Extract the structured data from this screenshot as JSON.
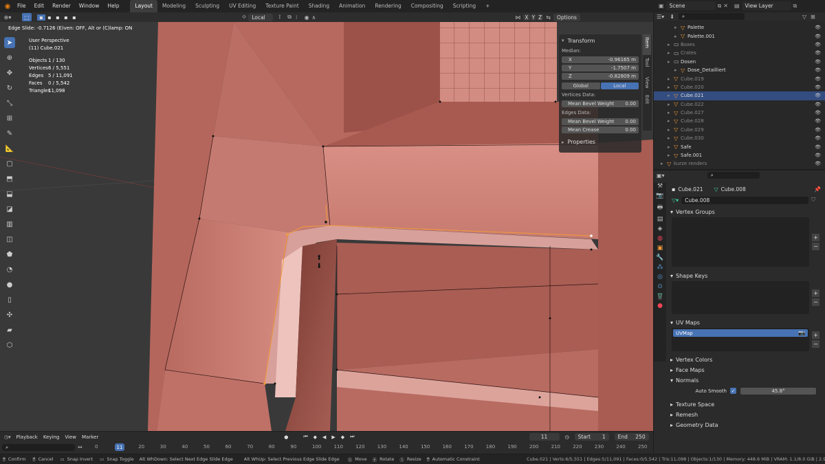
{
  "menu": [
    "File",
    "Edit",
    "Render",
    "Window",
    "Help"
  ],
  "workspaces": [
    "Layout",
    "Modeling",
    "Sculpting",
    "UV Editing",
    "Texture Paint",
    "Shading",
    "Animation",
    "Rendering",
    "Compositing",
    "Scripting"
  ],
  "scene": {
    "label": "Scene",
    "view_layer": "View Layer"
  },
  "viewport_header": {
    "transform_orientation": "Local",
    "options": "Options",
    "axes": [
      "X",
      "Y",
      "Z"
    ]
  },
  "status_msg": "Edge Slide: -0.7126 (E)ven: OFF, Alt or (C)lamp: ON",
  "overlay": {
    "view": "User Perspective",
    "object": "(11) Cube.021",
    "stats": [
      {
        "k": "Objects",
        "v": "1 / 130"
      },
      {
        "k": "Vertices",
        "v": "6 / 5,551"
      },
      {
        "k": "Edges",
        "v": "5 / 11,091"
      },
      {
        "k": "Faces",
        "v": "0 / 5,542"
      },
      {
        "k": "Triangles",
        "v": "11,098"
      }
    ]
  },
  "npanel": {
    "title": "Transform",
    "median": "Median:",
    "x_label": "X",
    "x": "-0.96165 m",
    "y_label": "Y",
    "y": "-1.7507 m",
    "z_label": "Z",
    "z": "-0.82809 m",
    "global": "Global",
    "local": "Local",
    "vertices_data": "Vertices Data:",
    "mean_bevel_weight_label": "Mean Bevel Weight",
    "v_bevel": "0.00",
    "edges_data": "Edges Data:",
    "e_bevel": "0.00",
    "mean_crease_label": "Mean Crease",
    "e_crease": "0.00",
    "properties": "Properties",
    "tabs": [
      "Item",
      "Tool",
      "View",
      "Edit"
    ]
  },
  "outliner": [
    {
      "name": "Palette",
      "indent": 2,
      "dim": false,
      "sel": false
    },
    {
      "name": "Palette.001",
      "indent": 2,
      "dim": false,
      "sel": false
    },
    {
      "name": "Boxes",
      "indent": 1,
      "dim": true,
      "sel": false
    },
    {
      "name": "Crates",
      "indent": 1,
      "dim": true,
      "sel": false
    },
    {
      "name": "Dosen",
      "indent": 1,
      "dim": false,
      "sel": false
    },
    {
      "name": "Dose_Detailliert",
      "indent": 2,
      "dim": false,
      "sel": false
    },
    {
      "name": "Cube.019",
      "indent": 1,
      "dim": true,
      "sel": false
    },
    {
      "name": "Cube.020",
      "indent": 1,
      "dim": true,
      "sel": false
    },
    {
      "name": "Cube.021",
      "indent": 1,
      "dim": false,
      "sel": true
    },
    {
      "name": "Cube.022",
      "indent": 1,
      "dim": true,
      "sel": false
    },
    {
      "name": "Cube.027",
      "indent": 1,
      "dim": true,
      "sel": false
    },
    {
      "name": "Cube.028",
      "indent": 1,
      "dim": true,
      "sel": false
    },
    {
      "name": "Cube.029",
      "indent": 1,
      "dim": true,
      "sel": false
    },
    {
      "name": "Cube.030",
      "indent": 1,
      "dim": true,
      "sel": false
    },
    {
      "name": "Safe",
      "indent": 1,
      "dim": false,
      "sel": false
    },
    {
      "name": "Safe.001",
      "indent": 1,
      "dim": false,
      "sel": false
    },
    {
      "name": "kurze renders",
      "indent": 0,
      "dim": true,
      "sel": false
    }
  ],
  "properties": {
    "object": "Cube.021",
    "mesh": "Cube.008",
    "mesh_field": "Cube.008",
    "vertex_groups": "Vertex Groups",
    "shape_keys": "Shape Keys",
    "uv_maps": "UV Maps",
    "uvmap": "UVMap",
    "vertex_colors": "Vertex Colors",
    "face_maps": "Face Maps",
    "normals": "Normals",
    "auto_smooth": "Auto Smooth",
    "angle": "45.8°",
    "texture_space": "Texture Space",
    "remesh": "Remesh",
    "geometry_data": "Geometry Data"
  },
  "timeline": {
    "playback": "Playback",
    "keying": "Keying",
    "view": "View",
    "marker": "Marker",
    "frame": "11",
    "start_label": "Start",
    "start": "1",
    "end_label": "End",
    "end": "250",
    "current_marker": "11",
    "ticks": [
      "0",
      "10",
      "20",
      "30",
      "40",
      "50",
      "60",
      "70",
      "80",
      "90",
      "100",
      "110",
      "120",
      "130",
      "140",
      "150",
      "160",
      "170",
      "180",
      "190",
      "200",
      "210",
      "220",
      "230",
      "240",
      "250"
    ]
  },
  "statusbar": {
    "confirm": "Confirm",
    "cancel": "Cancel",
    "snap_invert": "Snap Invert",
    "snap_toggle": "Snap Toggle",
    "next_edge": "Alt WhDown: Select Next Edge Slide Edge",
    "prev_edge": "Alt WhUp: Select Previous Edge Slide Edge",
    "move": "Move",
    "rotate": "Rotate",
    "resize": "Resize",
    "auto_constraint": "Automatic Constraint",
    "stats": "Cube.021 | Verts:6/5,551 | Edges:5/11,091 | Faces:0/5,542 | Tris:11,098 | Objects:1/130 | Memory: 448.6 MiB | VRAM: 1.1/8.0 GiB | 2.92"
  },
  "colors": {
    "accent": "#4772b3",
    "mesh": "#c97a70",
    "selection": "#f39a3a"
  }
}
